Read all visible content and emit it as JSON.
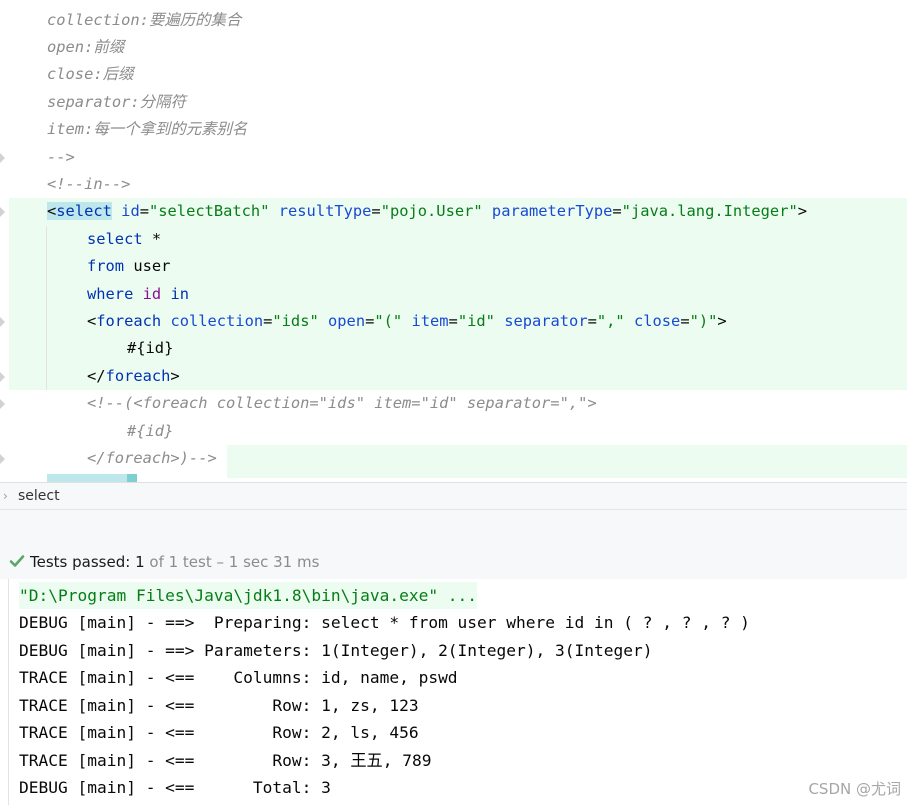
{
  "editor": {
    "lines": [
      {
        "id": "doc-collection",
        "kind": "doc",
        "key": "collection:",
        "text": "要遍历的集合"
      },
      {
        "id": "doc-open",
        "kind": "doc",
        "key": "open:",
        "text": "前缀"
      },
      {
        "id": "doc-close",
        "kind": "doc",
        "key": "close:",
        "text": "后缀"
      },
      {
        "id": "doc-separator",
        "kind": "doc",
        "key": "separator:",
        "text": "分隔符"
      },
      {
        "id": "doc-item",
        "kind": "doc",
        "key": "item:",
        "text": "每一个拿到的元素别名"
      },
      {
        "id": "comment-end",
        "kind": "plaincomment",
        "text": "-->"
      },
      {
        "id": "comment-in",
        "kind": "plaincomment",
        "text": "<!--in-->"
      },
      {
        "id": "select-open-tag",
        "kind": "select-tag",
        "tag_open": "<",
        "tag": "select",
        "attrs": [
          {
            "name": "id",
            "value": "\"selectBatch\""
          },
          {
            "name": "resultType",
            "value": "\"pojo.User\""
          },
          {
            "name": "parameterType",
            "value": "\"java.lang.Integer\""
          }
        ],
        "tag_close": ">"
      },
      {
        "id": "sql-select",
        "kind": "sql",
        "indent": 4,
        "segments": [
          {
            "c": "k",
            "t": "select"
          },
          {
            "c": "x",
            "t": " *"
          }
        ]
      },
      {
        "id": "sql-from",
        "kind": "sql",
        "indent": 4,
        "segments": [
          {
            "c": "k",
            "t": "from"
          },
          {
            "c": "x",
            "t": " user"
          }
        ]
      },
      {
        "id": "sql-where",
        "kind": "sql",
        "indent": 4,
        "segments": [
          {
            "c": "k",
            "t": "where"
          },
          {
            "c": "x",
            "t": " "
          },
          {
            "c": "p",
            "t": "id"
          },
          {
            "c": "x",
            "t": " "
          },
          {
            "c": "k",
            "t": "in"
          }
        ]
      },
      {
        "id": "foreach-open-tag",
        "kind": "tag",
        "indent": 4,
        "tag_open": "<",
        "tag": "foreach",
        "attrs": [
          {
            "name": "collection",
            "value": "\"ids\""
          },
          {
            "name": "open",
            "value": "\"(\""
          },
          {
            "name": "item",
            "value": "\"id\""
          },
          {
            "name": "separator",
            "value": "\",\""
          },
          {
            "name": "close",
            "value": "\")\""
          }
        ],
        "tag_close": ">"
      },
      {
        "id": "foreach-body",
        "kind": "sql",
        "indent": 8,
        "segments": [
          {
            "c": "x",
            "t": "#{id}"
          }
        ]
      },
      {
        "id": "foreach-close-tag",
        "kind": "tag",
        "indent": 4,
        "tag_open": "</",
        "tag": "foreach",
        "attrs": [],
        "tag_close": ">"
      },
      {
        "id": "commented-foreach-open",
        "kind": "plaincomment",
        "indent": 4,
        "text": "<!--(<foreach collection=\"ids\" item=\"id\" separator=\",\">"
      },
      {
        "id": "commented-foreach-body",
        "kind": "plaincomment",
        "indent": 8,
        "text": "#{id}"
      },
      {
        "id": "commented-foreach-close",
        "kind": "plaincomment",
        "indent": 4,
        "text": "</foreach>)-->"
      }
    ]
  },
  "breadcrumb": {
    "item": "select"
  },
  "tests": {
    "label": "Tests passed:",
    "count": "1",
    "detail": "of 1 test – 1 sec 31 ms",
    "status_color": "#59a869"
  },
  "console": {
    "lines": [
      "\"D:\\Program Files\\Java\\jdk1.8\\bin\\java.exe\" ...",
      "DEBUG [main] - ==>  Preparing: select * from user where id in ( ? , ? , ? )",
      "DEBUG [main] - ==> Parameters: 1(Integer), 2(Integer), 3(Integer)",
      "TRACE [main] - <==    Columns: id, name, pswd",
      "TRACE [main] - <==        Row: 1, zs, 123",
      "TRACE [main] - <==        Row: 2, ls, 456",
      "TRACE [main] - <==        Row: 3, 王五, 789",
      "DEBUG [main] - <==      Total: 3"
    ]
  },
  "watermark": "CSDN @尤词"
}
